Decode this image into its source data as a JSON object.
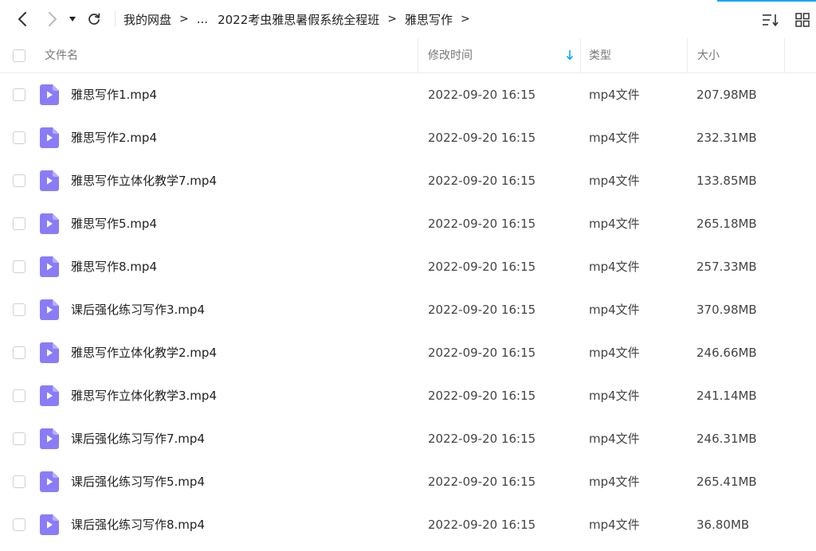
{
  "colors": {
    "accent": "#06a7ff",
    "video_icon": "#8a7cf7",
    "video_icon_fold": "#b9aff9"
  },
  "breadcrumb": {
    "root": "我的网盘",
    "ellipsis": "...",
    "items": [
      "2022考虫雅思暑假系统全程班",
      "雅思写作"
    ],
    "separator": ">"
  },
  "toolbar": {
    "icons": [
      "back-icon",
      "forward-icon",
      "dropdown-icon",
      "refresh-icon",
      "sort-list-icon",
      "grid-view-icon"
    ]
  },
  "columns": {
    "name": "文件名",
    "modified": "修改时间",
    "type": "类型",
    "size": "大小"
  },
  "files": [
    {
      "name": "雅思写作1.mp4",
      "modified": "2022-09-20 16:15",
      "type": "mp4文件",
      "size": "207.98MB"
    },
    {
      "name": "雅思写作2.mp4",
      "modified": "2022-09-20 16:15",
      "type": "mp4文件",
      "size": "232.31MB"
    },
    {
      "name": "雅思写作立体化教学7.mp4",
      "modified": "2022-09-20 16:15",
      "type": "mp4文件",
      "size": "133.85MB"
    },
    {
      "name": "雅思写作5.mp4",
      "modified": "2022-09-20 16:15",
      "type": "mp4文件",
      "size": "265.18MB"
    },
    {
      "name": "雅思写作8.mp4",
      "modified": "2022-09-20 16:15",
      "type": "mp4文件",
      "size": "257.33MB"
    },
    {
      "name": "课后强化练习写作3.mp4",
      "modified": "2022-09-20 16:15",
      "type": "mp4文件",
      "size": "370.98MB"
    },
    {
      "name": "雅思写作立体化教学2.mp4",
      "modified": "2022-09-20 16:15",
      "type": "mp4文件",
      "size": "246.66MB"
    },
    {
      "name": "雅思写作立体化教学3.mp4",
      "modified": "2022-09-20 16:15",
      "type": "mp4文件",
      "size": "241.14MB"
    },
    {
      "name": "课后强化练习写作7.mp4",
      "modified": "2022-09-20 16:15",
      "type": "mp4文件",
      "size": "246.31MB"
    },
    {
      "name": "课后强化练习写作5.mp4",
      "modified": "2022-09-20 16:15",
      "type": "mp4文件",
      "size": "265.41MB"
    },
    {
      "name": "课后强化练习写作8.mp4",
      "modified": "2022-09-20 16:15",
      "type": "mp4文件",
      "size": "36.80MB"
    }
  ]
}
